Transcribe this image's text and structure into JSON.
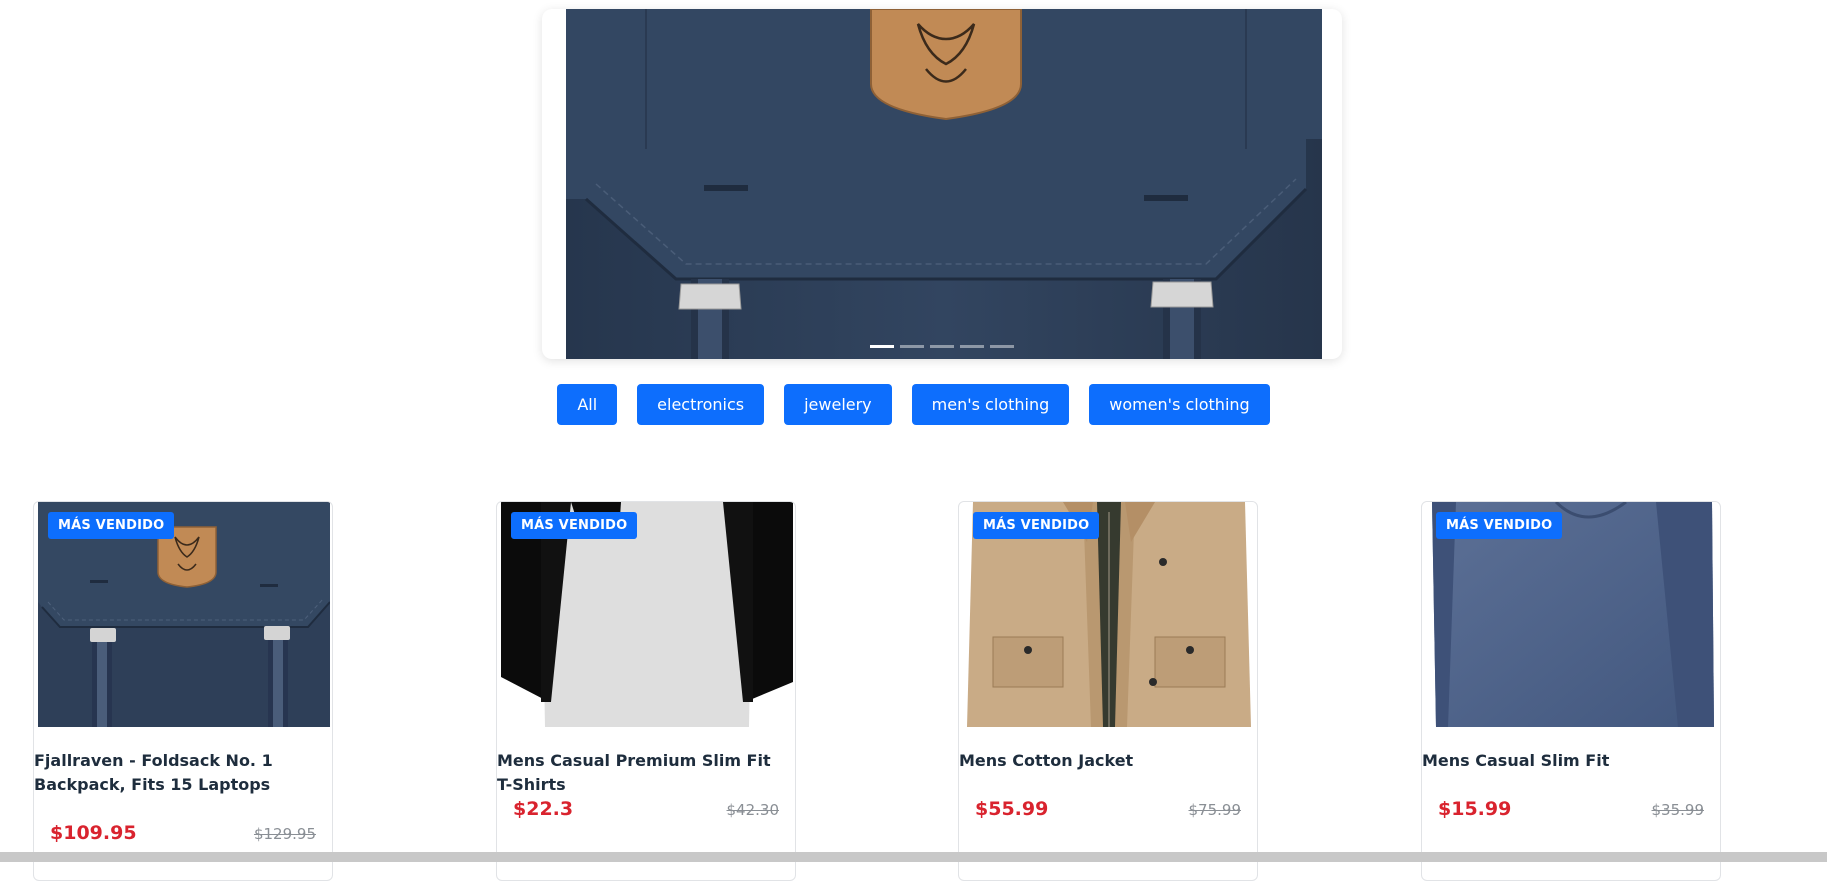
{
  "carousel": {
    "slide_count": 5,
    "active_index": 0
  },
  "filters": [
    {
      "label": "All"
    },
    {
      "label": "electronics"
    },
    {
      "label": "jewelery"
    },
    {
      "label": "men's clothing"
    },
    {
      "label": "women's clothing"
    }
  ],
  "products": [
    {
      "badge": "MÁS VENDIDO",
      "title": "Fjallraven - Foldsack No. 1 Backpack, Fits 15 Laptops",
      "price": "$109.95",
      "old_price": "$129.95",
      "image_icon": "backpack"
    },
    {
      "badge": "MÁS VENDIDO",
      "title": "Mens Casual Premium Slim Fit T-Shirts",
      "price": "$22.3",
      "old_price": "$42.30",
      "image_icon": "raglan-tshirt"
    },
    {
      "badge": "MÁS VENDIDO",
      "title": "Mens Cotton Jacket",
      "price": "$55.99",
      "old_price": "$75.99",
      "image_icon": "jacket"
    },
    {
      "badge": "MÁS VENDIDO",
      "title": "Mens Casual Slim Fit",
      "price": "$15.99",
      "old_price": "$35.99",
      "image_icon": "long-sleeve-shirt"
    }
  ],
  "colors": {
    "primary": "#0d6efd",
    "price": "#d9232e",
    "old_price": "#8a8f95",
    "backpack_navy": "#2e3f58",
    "leather_patch": "#c18a55"
  }
}
